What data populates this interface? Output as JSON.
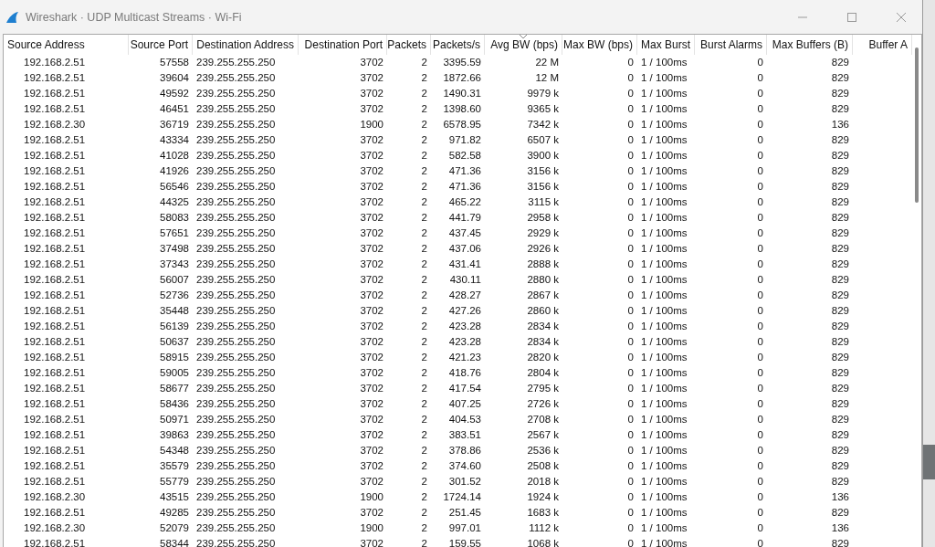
{
  "window": {
    "title": "Wireshark · UDP Multicast Streams · Wi-Fi"
  },
  "table": {
    "columns": [
      {
        "label": "Source Address",
        "sorted": false
      },
      {
        "label": "Source Port",
        "sorted": false
      },
      {
        "label": "Destination Address",
        "sorted": false
      },
      {
        "label": "Destination Port",
        "sorted": false
      },
      {
        "label": "Packets",
        "sorted": false
      },
      {
        "label": "Packets/s",
        "sorted": false
      },
      {
        "label": "Avg BW (bps)",
        "sorted": true
      },
      {
        "label": "Max BW (bps)",
        "sorted": false
      },
      {
        "label": "Max Burst",
        "sorted": false
      },
      {
        "label": "Burst Alarms",
        "sorted": false
      },
      {
        "label": "Max Buffers (B)",
        "sorted": false
      },
      {
        "label": "Buffer A",
        "sorted": false
      }
    ],
    "rows": [
      [
        "192.168.2.51",
        "57558",
        "239.255.255.250",
        "3702",
        "2",
        "3395.59",
        "22 M",
        "0",
        "1 / 100ms",
        "0",
        "829"
      ],
      [
        "192.168.2.51",
        "39604",
        "239.255.255.250",
        "3702",
        "2",
        "1872.66",
        "12 M",
        "0",
        "1 / 100ms",
        "0",
        "829"
      ],
      [
        "192.168.2.51",
        "49592",
        "239.255.255.250",
        "3702",
        "2",
        "1490.31",
        "9979 k",
        "0",
        "1 / 100ms",
        "0",
        "829"
      ],
      [
        "192.168.2.51",
        "46451",
        "239.255.255.250",
        "3702",
        "2",
        "1398.60",
        "9365 k",
        "0",
        "1 / 100ms",
        "0",
        "829"
      ],
      [
        "192.168.2.30",
        "36719",
        "239.255.255.250",
        "1900",
        "2",
        "6578.95",
        "7342 k",
        "0",
        "1 / 100ms",
        "0",
        "136"
      ],
      [
        "192.168.2.51",
        "43334",
        "239.255.255.250",
        "3702",
        "2",
        "971.82",
        "6507 k",
        "0",
        "1 / 100ms",
        "0",
        "829"
      ],
      [
        "192.168.2.51",
        "41028",
        "239.255.255.250",
        "3702",
        "2",
        "582.58",
        "3900 k",
        "0",
        "1 / 100ms",
        "0",
        "829"
      ],
      [
        "192.168.2.51",
        "41926",
        "239.255.255.250",
        "3702",
        "2",
        "471.36",
        "3156 k",
        "0",
        "1 / 100ms",
        "0",
        "829"
      ],
      [
        "192.168.2.51",
        "56546",
        "239.255.255.250",
        "3702",
        "2",
        "471.36",
        "3156 k",
        "0",
        "1 / 100ms",
        "0",
        "829"
      ],
      [
        "192.168.2.51",
        "44325",
        "239.255.255.250",
        "3702",
        "2",
        "465.22",
        "3115 k",
        "0",
        "1 / 100ms",
        "0",
        "829"
      ],
      [
        "192.168.2.51",
        "58083",
        "239.255.255.250",
        "3702",
        "2",
        "441.79",
        "2958 k",
        "0",
        "1 / 100ms",
        "0",
        "829"
      ],
      [
        "192.168.2.51",
        "57651",
        "239.255.255.250",
        "3702",
        "2",
        "437.45",
        "2929 k",
        "0",
        "1 / 100ms",
        "0",
        "829"
      ],
      [
        "192.168.2.51",
        "37498",
        "239.255.255.250",
        "3702",
        "2",
        "437.06",
        "2926 k",
        "0",
        "1 / 100ms",
        "0",
        "829"
      ],
      [
        "192.168.2.51",
        "37343",
        "239.255.255.250",
        "3702",
        "2",
        "431.41",
        "2888 k",
        "0",
        "1 / 100ms",
        "0",
        "829"
      ],
      [
        "192.168.2.51",
        "56007",
        "239.255.255.250",
        "3702",
        "2",
        "430.11",
        "2880 k",
        "0",
        "1 / 100ms",
        "0",
        "829"
      ],
      [
        "192.168.2.51",
        "52736",
        "239.255.255.250",
        "3702",
        "2",
        "428.27",
        "2867 k",
        "0",
        "1 / 100ms",
        "0",
        "829"
      ],
      [
        "192.168.2.51",
        "35448",
        "239.255.255.250",
        "3702",
        "2",
        "427.26",
        "2860 k",
        "0",
        "1 / 100ms",
        "0",
        "829"
      ],
      [
        "192.168.2.51",
        "56139",
        "239.255.255.250",
        "3702",
        "2",
        "423.28",
        "2834 k",
        "0",
        "1 / 100ms",
        "0",
        "829"
      ],
      [
        "192.168.2.51",
        "50637",
        "239.255.255.250",
        "3702",
        "2",
        "423.28",
        "2834 k",
        "0",
        "1 / 100ms",
        "0",
        "829"
      ],
      [
        "192.168.2.51",
        "58915",
        "239.255.255.250",
        "3702",
        "2",
        "421.23",
        "2820 k",
        "0",
        "1 / 100ms",
        "0",
        "829"
      ],
      [
        "192.168.2.51",
        "59005",
        "239.255.255.250",
        "3702",
        "2",
        "418.76",
        "2804 k",
        "0",
        "1 / 100ms",
        "0",
        "829"
      ],
      [
        "192.168.2.51",
        "58677",
        "239.255.255.250",
        "3702",
        "2",
        "417.54",
        "2795 k",
        "0",
        "1 / 100ms",
        "0",
        "829"
      ],
      [
        "192.168.2.51",
        "58436",
        "239.255.255.250",
        "3702",
        "2",
        "407.25",
        "2726 k",
        "0",
        "1 / 100ms",
        "0",
        "829"
      ],
      [
        "192.168.2.51",
        "50971",
        "239.255.255.250",
        "3702",
        "2",
        "404.53",
        "2708 k",
        "0",
        "1 / 100ms",
        "0",
        "829"
      ],
      [
        "192.168.2.51",
        "39863",
        "239.255.255.250",
        "3702",
        "2",
        "383.51",
        "2567 k",
        "0",
        "1 / 100ms",
        "0",
        "829"
      ],
      [
        "192.168.2.51",
        "54348",
        "239.255.255.250",
        "3702",
        "2",
        "378.86",
        "2536 k",
        "0",
        "1 / 100ms",
        "0",
        "829"
      ],
      [
        "192.168.2.51",
        "35579",
        "239.255.255.250",
        "3702",
        "2",
        "374.60",
        "2508 k",
        "0",
        "1 / 100ms",
        "0",
        "829"
      ],
      [
        "192.168.2.51",
        "55779",
        "239.255.255.250",
        "3702",
        "2",
        "301.52",
        "2018 k",
        "0",
        "1 / 100ms",
        "0",
        "829"
      ],
      [
        "192.168.2.30",
        "43515",
        "239.255.255.250",
        "1900",
        "2",
        "1724.14",
        "1924 k",
        "0",
        "1 / 100ms",
        "0",
        "136"
      ],
      [
        "192.168.2.51",
        "49285",
        "239.255.255.250",
        "3702",
        "2",
        "251.45",
        "1683 k",
        "0",
        "1 / 100ms",
        "0",
        "829"
      ],
      [
        "192.168.2.30",
        "52079",
        "239.255.255.250",
        "1900",
        "2",
        "997.01",
        "1112 k",
        "0",
        "1 / 100ms",
        "0",
        "136"
      ],
      [
        "192.168.2.51",
        "58344",
        "239.255.255.250",
        "3702",
        "2",
        "159.55",
        "1068 k",
        "0",
        "1 / 100ms",
        "0",
        "829"
      ]
    ]
  }
}
